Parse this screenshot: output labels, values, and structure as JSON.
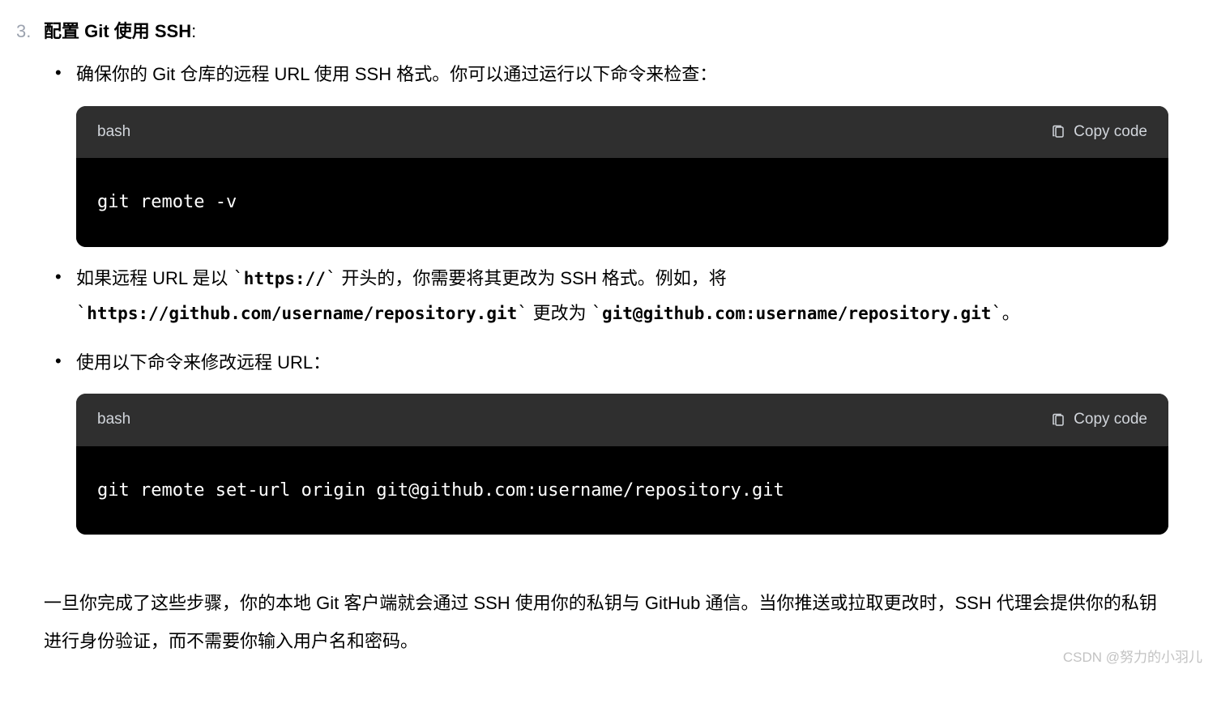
{
  "listNumber": "3.",
  "heading": "配置 Git 使用 SSH",
  "headingColon": ":",
  "bullets": {
    "b1": {
      "text": "确保你的 Git 仓库的远程 URL 使用 SSH 格式。你可以通过运行以下命令来检查："
    },
    "b2": {
      "prefix": "如果远程 URL 是以 ",
      "code1": "https://",
      "mid1": " 开头的，你需要将其更改为 SSH 格式。例如，将 ",
      "code2": "https://github.com/username/repository.git",
      "mid2": " 更改为 ",
      "code3": "git@github.com:username/repository.git",
      "suffix": "。"
    },
    "b3": {
      "text": "使用以下命令来修改远程 URL："
    }
  },
  "codeBlocks": {
    "cb1": {
      "lang": "bash",
      "copy": "Copy code",
      "code": "git remote -v"
    },
    "cb2": {
      "lang": "bash",
      "copy": "Copy code",
      "code": "git remote set-url origin git@github.com:username/repository.git"
    }
  },
  "tick": "`",
  "closing": "一旦你完成了这些步骤，你的本地 Git 客户端就会通过 SSH 使用你的私钥与 GitHub 通信。当你推送或拉取更改时，SSH 代理会提供你的私钥进行身份验证，而不需要你输入用户名和密码。",
  "watermark": "CSDN @努力的小羽儿"
}
